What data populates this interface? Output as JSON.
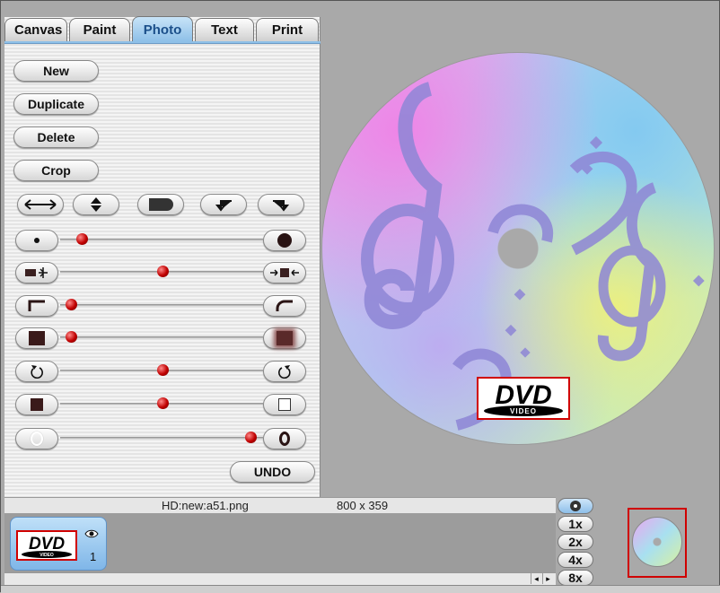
{
  "tabs": [
    "Canvas",
    "Paint",
    "Photo",
    "Text",
    "Print"
  ],
  "active_tab": "Photo",
  "photo_buttons": {
    "new": "New",
    "duplicate": "Duplicate",
    "delete": "Delete",
    "crop": "Crop",
    "undo": "UNDO"
  },
  "transform_icons": [
    "flip-horizontal-icon",
    "flip-vertical-icon",
    "mask-shape-icon",
    "rotate-left-icon",
    "rotate-right-icon"
  ],
  "sliders": [
    {
      "name": "brush-size",
      "left_icon": "small-dot-icon",
      "right_icon": "large-dot-icon",
      "level": 0.0
    },
    {
      "name": "contrast",
      "left_icon": "expand-icon",
      "right_icon": "compress-icon",
      "level": 0.5
    },
    {
      "name": "corner-radius",
      "left_icon": "square-corner-icon",
      "right_icon": "round-corner-icon",
      "level": 0.0
    },
    {
      "name": "blur",
      "left_icon": "sharp-square-icon",
      "right_icon": "blurred-square-icon",
      "level": 0.0
    },
    {
      "name": "rotation",
      "left_icon": "rotate-cw-icon",
      "right_icon": "rotate-ccw-icon",
      "level": 0.5
    },
    {
      "name": "opacity",
      "left_icon": "filled-square-icon",
      "right_icon": "empty-square-icon",
      "level": 0.5
    },
    {
      "name": "outline",
      "left_icon": "thin-circle-icon",
      "right_icon": "thick-circle-icon",
      "level": 1.0
    }
  ],
  "status": {
    "file": "HD:new:a51.png",
    "dimensions": "800 x 359"
  },
  "layer": {
    "number": "1",
    "logo_text": "DVD",
    "logo_sub": "VIDEO"
  },
  "zoom_levels": [
    "1x",
    "2x",
    "4x",
    "8x"
  ],
  "disc_logo": {
    "text": "DVD",
    "sub": "VIDEO"
  },
  "colors": {
    "accent_tab": "#8ec0e8",
    "knob": "#c00000",
    "selection": "#d00000"
  }
}
